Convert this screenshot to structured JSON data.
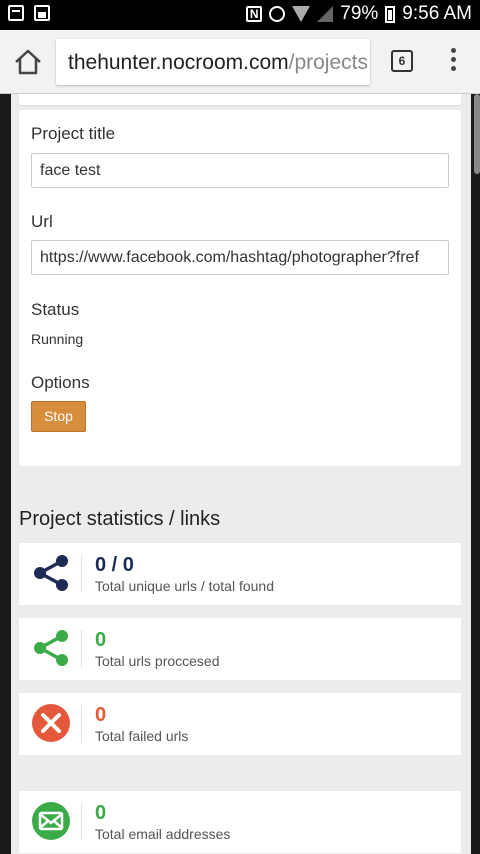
{
  "status_bar": {
    "battery": "79%",
    "time": "9:56 AM"
  },
  "browser": {
    "url_host": "thehunter.nocroom.com",
    "url_path": "/projects",
    "tab_count": "6"
  },
  "project": {
    "title_label": "Project title",
    "title_value": "face test",
    "url_label": "Url",
    "url_value": "https://www.facebook.com/hashtag/photographer?fref",
    "status_label": "Status",
    "status_value": "Running",
    "options_label": "Options",
    "stop_label": "Stop"
  },
  "statistics": {
    "title": "Project statistics / links",
    "items": [
      {
        "value": "0 / 0",
        "label": "Total unique urls / total found",
        "color": "#1d2b55",
        "icon": "share-icon"
      },
      {
        "value": "0",
        "label": "Total urls proccesed",
        "color": "#3bab48",
        "icon": "share-icon"
      },
      {
        "value": "0",
        "label": "Total failed urls",
        "color": "#e4593b",
        "icon": "close-circle-icon"
      },
      {
        "value": "0",
        "label": "Total email addresses",
        "color": "#3bab48",
        "icon": "envelope-icon"
      }
    ]
  }
}
